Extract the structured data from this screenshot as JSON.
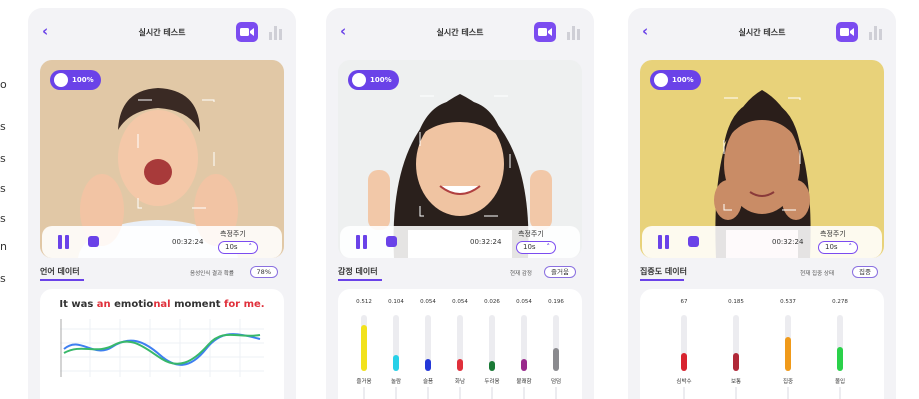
{
  "side_text": [
    "o",
    "s",
    "s",
    "s",
    "s",
    "n",
    "s"
  ],
  "panels": [
    {
      "title": "실시간 테스트",
      "badge": "100%",
      "time": "00:32:24",
      "measure_label": "측정주기",
      "measure_value": "10s",
      "section_title": "언어 데이터",
      "status_label": "음성인식 결과 확률",
      "status_value": "78%",
      "sentence": {
        "a": "It was ",
        "b": "an",
        "c": " emotio",
        "d": "nal",
        "e": " moment",
        "f": " for me."
      }
    },
    {
      "title": "실시간 테스트",
      "badge": "100%",
      "time": "00:32:24",
      "measure_label": "측정주기",
      "measure_value": "10s",
      "section_title": "감정 데이터",
      "status_label": "현재 감정",
      "status_value": "즐거움",
      "bars": [
        {
          "name": "즐거움",
          "value": 0.512,
          "label": "0.512",
          "color": "#f2e21b"
        },
        {
          "name": "놀람",
          "value": 0.104,
          "label": "0.104",
          "color": "#27d0e8"
        },
        {
          "name": "슬픔",
          "value": 0.054,
          "label": "0.054",
          "color": "#2438d8"
        },
        {
          "name": "화남",
          "value": 0.054,
          "label": "0.054",
          "color": "#e0303b"
        },
        {
          "name": "두려움",
          "value": 0.026,
          "label": "0.026",
          "color": "#1a7a36"
        },
        {
          "name": "불쾌함",
          "value": 0.054,
          "label": "0.054",
          "color": "#9a2a8c"
        },
        {
          "name": "덤덤",
          "value": 0.196,
          "label": "0.196",
          "color": "#8a8a8e"
        }
      ]
    },
    {
      "title": "실시간 테스트",
      "badge": "100%",
      "time": "00:32:24",
      "measure_label": "측정주기",
      "measure_value": "10s",
      "section_title": "집중도 데이터",
      "status_label": "현재 집중 상태",
      "status_value": "집중",
      "bars": [
        {
          "name": "심박수",
          "value": 67,
          "label": "67",
          "fill": 0.33,
          "color": "#d8232f"
        },
        {
          "name": "보통",
          "value": 0.185,
          "label": "0.185",
          "fill": 0.33,
          "color": "#b02838"
        },
        {
          "name": "집중",
          "value": 0.537,
          "label": "0.537",
          "fill": 0.6,
          "color": "#f09a1a"
        },
        {
          "name": "몰입",
          "value": 0.278,
          "label": "0.278",
          "fill": 0.42,
          "color": "#2ad14a"
        }
      ]
    }
  ],
  "colors": {
    "accent": "#6a42e8",
    "panel_bg": "#f3f3f6",
    "line_green": "#38b86a",
    "line_blue": "#3e7ff0"
  }
}
